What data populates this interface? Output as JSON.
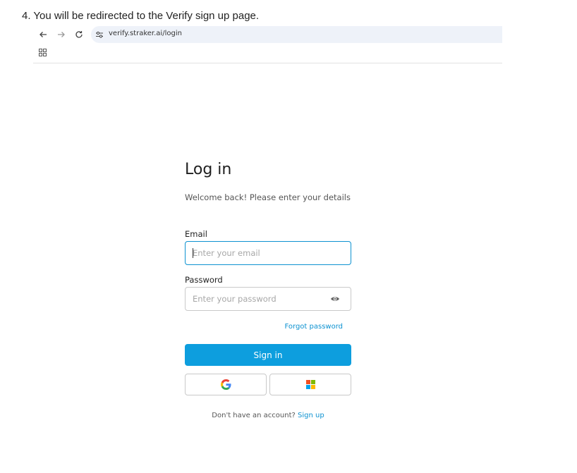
{
  "instruction": {
    "step_text": "4. You will be redirected to the Verify sign up page."
  },
  "browser": {
    "url": "verify.straker.ai/login",
    "icons": [
      "back-icon",
      "forward-icon",
      "reload-icon",
      "site-info-icon",
      "apps-icon"
    ]
  },
  "login": {
    "title": "Log in",
    "subtitle": "Welcome back! Please enter your details",
    "email_label": "Email",
    "email_placeholder": "Enter your email",
    "password_label": "Password",
    "password_placeholder": "Enter your password",
    "forgot_password": "Forgot password",
    "sign_in_label": "Sign in",
    "no_account_text": "Don't have an account?",
    "sign_up_label": "Sign up",
    "oauth": [
      "google-icon",
      "microsoft-icon"
    ]
  },
  "colors": {
    "accent": "#0d9ede",
    "link": "#0d92d1",
    "address_bar": "#eef2f9"
  }
}
